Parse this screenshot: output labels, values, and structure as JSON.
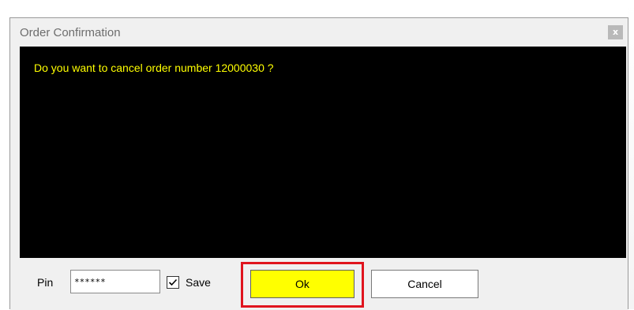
{
  "dialog": {
    "title": "Order Confirmation",
    "close_glyph": "x",
    "message": "Do you want to cancel order number 12000030 ?"
  },
  "form": {
    "pin_label": "Pin",
    "pin_value": "******",
    "save_label": "Save",
    "save_checked": true,
    "ok_label": "Ok",
    "cancel_label": "Cancel"
  },
  "colors": {
    "message_background": "#000000",
    "message_text": "#ffff00",
    "ok_button": "#ffff00",
    "highlight_border": "#e0141e"
  },
  "icons": {
    "close": "close-icon",
    "checkbox": "checkmark-icon"
  }
}
